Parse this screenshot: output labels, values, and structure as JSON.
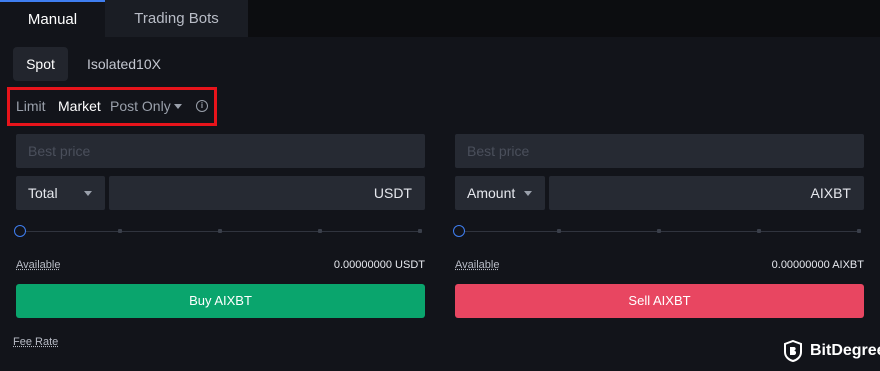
{
  "tabs": {
    "manual": "Manual",
    "bots": "Trading Bots"
  },
  "mode": {
    "spot": "Spot",
    "isolated": "Isolated10X"
  },
  "order_types": {
    "limit": "Limit",
    "market": "Market",
    "post_only": "Post Only"
  },
  "buy": {
    "price_placeholder": "Best price",
    "amount_mode": "Total",
    "unit": "USDT",
    "slider_value_percent": 0,
    "available_label": "Available",
    "available_value": "0.00000000 USDT",
    "button_label": "Buy AIXBT"
  },
  "sell": {
    "price_placeholder": "Best price",
    "amount_mode": "Amount",
    "unit": "AIXBT",
    "slider_value_percent": 0,
    "available_label": "Available",
    "available_value": "0.00000000 AIXBT",
    "button_label": "Sell AIXBT"
  },
  "fee_rate_label": "Fee Rate",
  "brand": {
    "name": "BitDegree",
    "logo_icon": "shield-logo-icon"
  },
  "colors": {
    "accent": "#3f7ef0",
    "buy": "#0aa56d",
    "sell": "#e84661",
    "highlight": "#e8141b"
  }
}
